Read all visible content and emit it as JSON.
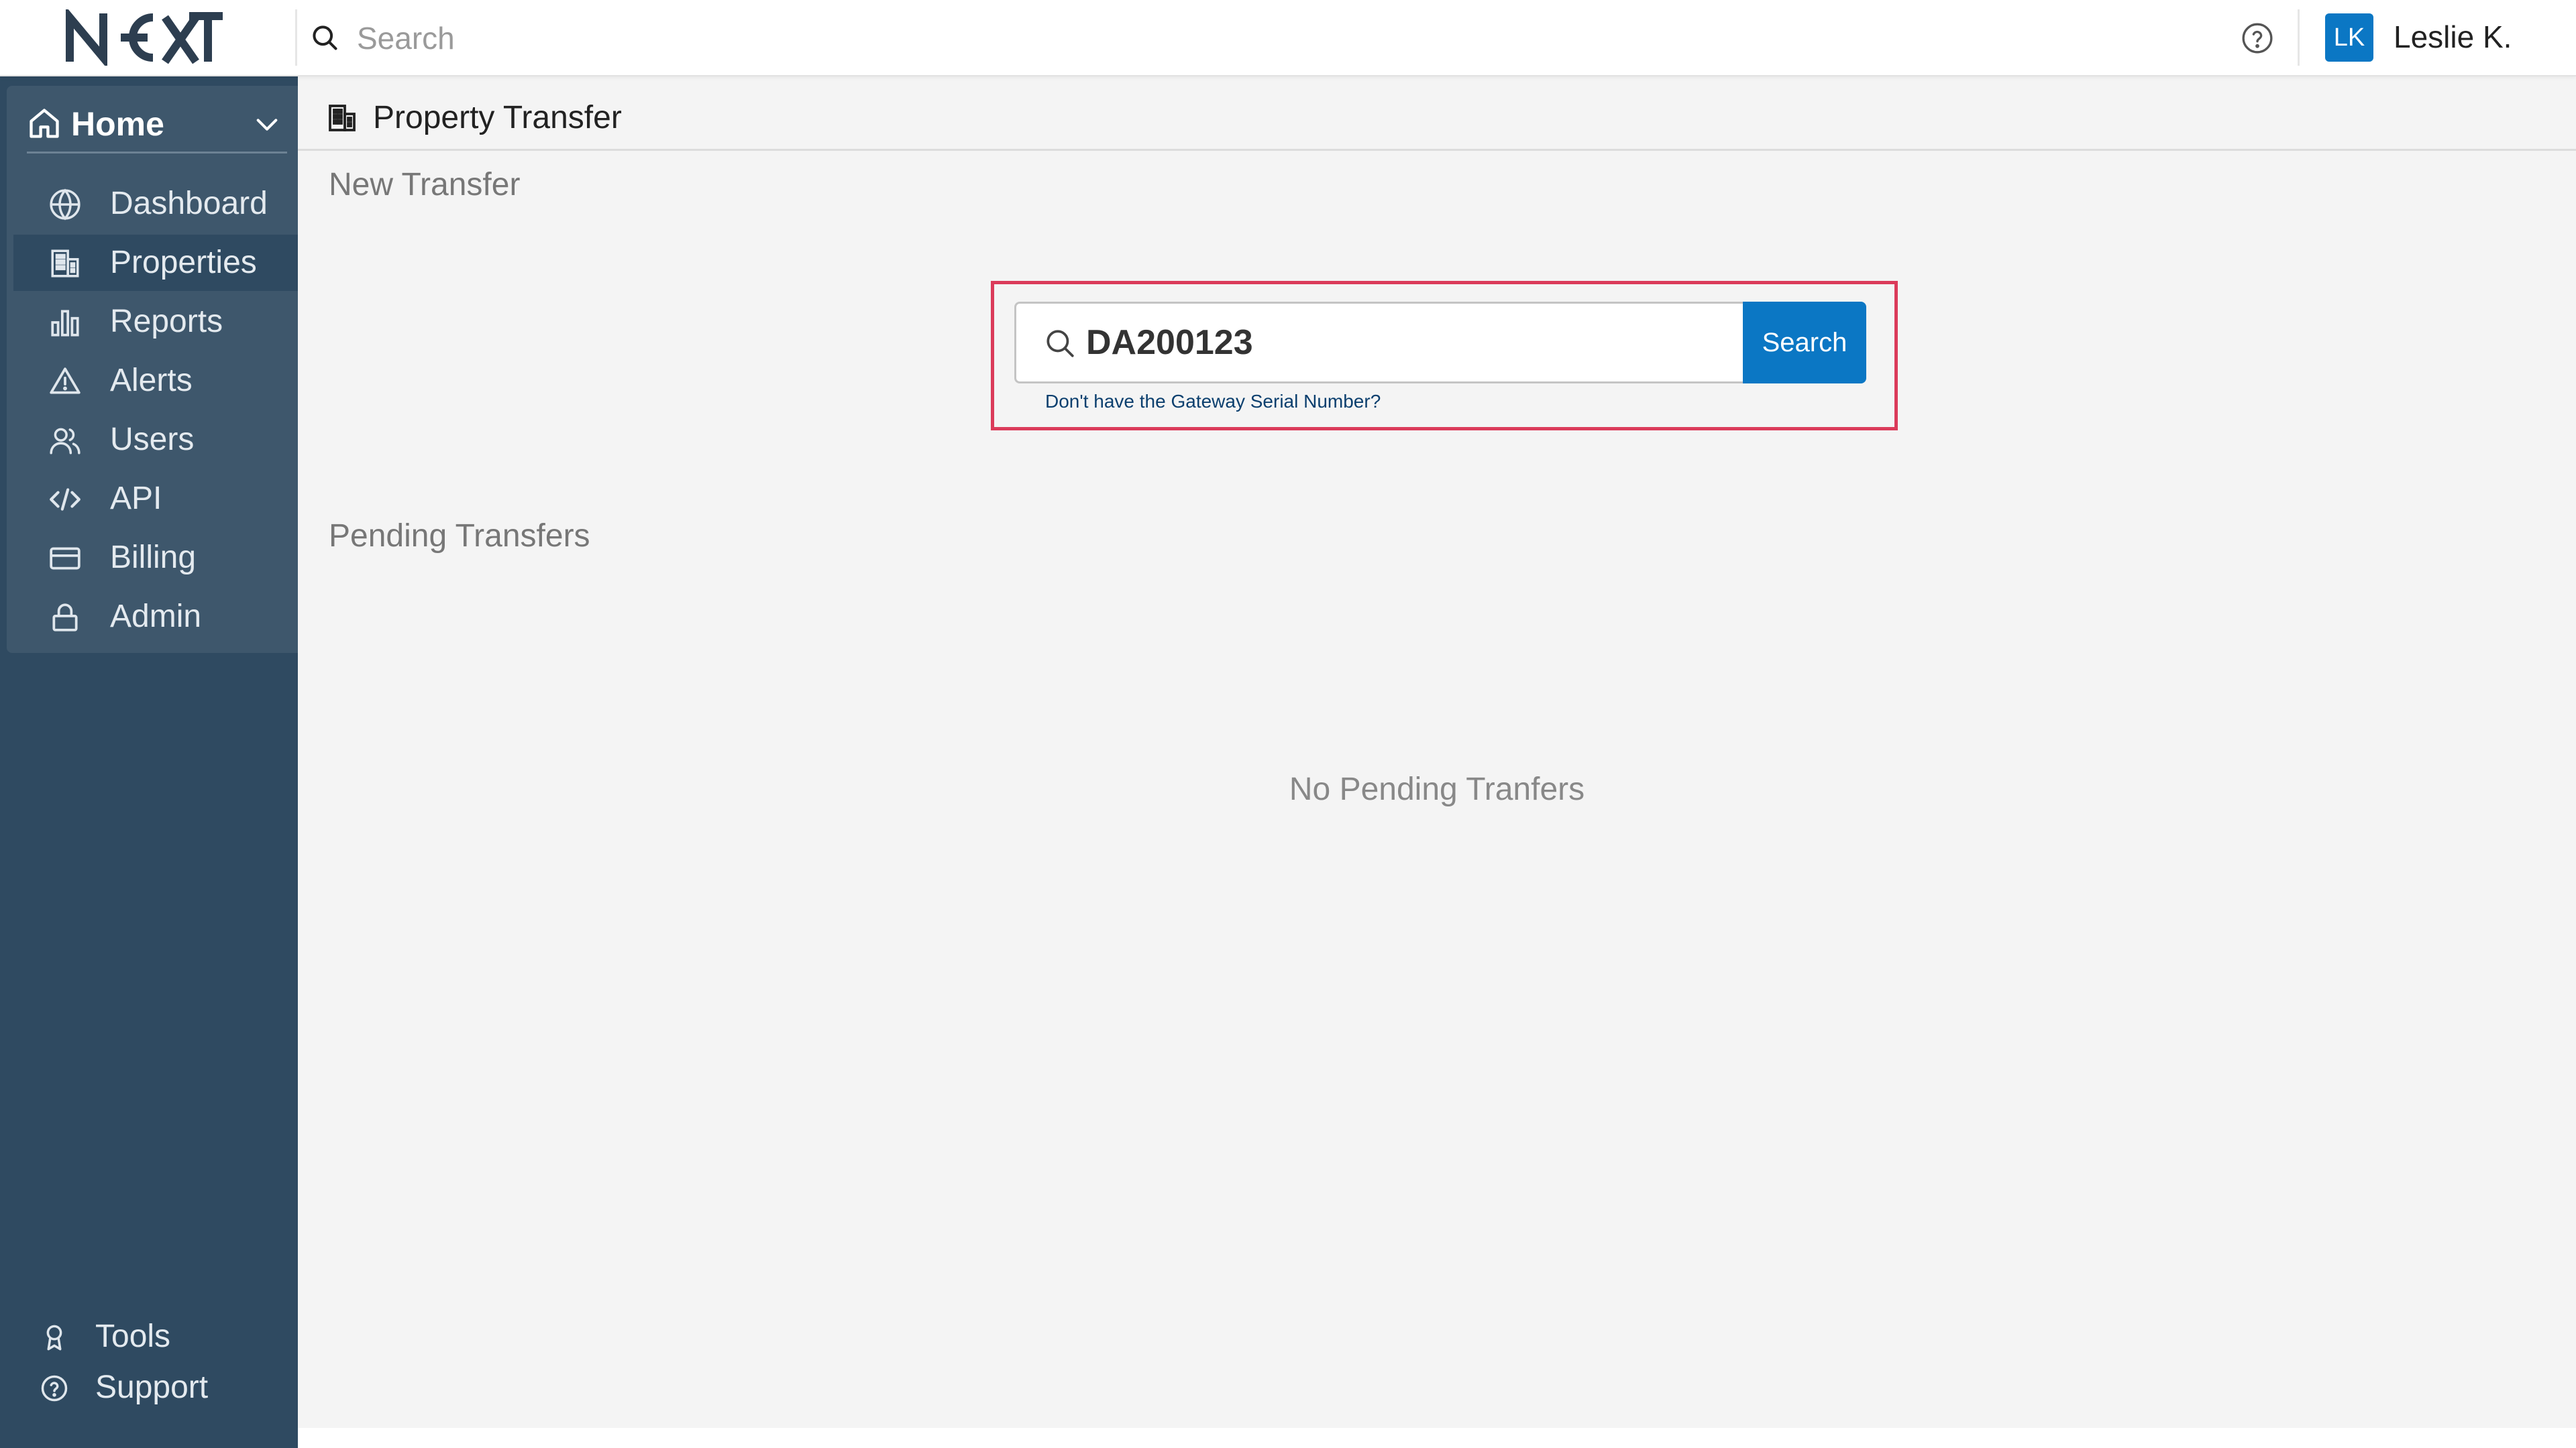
{
  "topbar": {
    "logo_text": "NEXT",
    "search_placeholder": "Search",
    "user": {
      "initials": "LK",
      "name": "Leslie K."
    }
  },
  "sidebar": {
    "home": {
      "label": "Home",
      "icon": "home-icon"
    },
    "items": [
      {
        "label": "Dashboard",
        "icon": "globe-icon",
        "active": false
      },
      {
        "label": "Properties",
        "icon": "building-icon",
        "active": true
      },
      {
        "label": "Reports",
        "icon": "bar-chart-icon",
        "active": false
      },
      {
        "label": "Alerts",
        "icon": "warning-icon",
        "active": false
      },
      {
        "label": "Users",
        "icon": "users-icon",
        "active": false
      },
      {
        "label": "API",
        "icon": "code-icon",
        "active": false
      },
      {
        "label": "Billing",
        "icon": "credit-card-icon",
        "active": false
      },
      {
        "label": "Admin",
        "icon": "lock-icon",
        "active": false
      }
    ],
    "footer": [
      {
        "label": "Tools",
        "icon": "award-icon"
      },
      {
        "label": "Support",
        "icon": "help-circle-icon"
      }
    ]
  },
  "page": {
    "title": "Property Transfer",
    "new_transfer": {
      "heading": "New Transfer",
      "serial_value": "DA200123",
      "search_button": "Search",
      "help_link": "Don't have the Gateway Serial Number?"
    },
    "pending": {
      "heading": "Pending Transfers",
      "empty_message": "No Pending Tranfers"
    }
  },
  "colors": {
    "sidebar_bg": "#2f4a61",
    "nav_panel_bg": "#3e576c",
    "accent": "#0b77c4",
    "highlight": "#db3b5a"
  }
}
